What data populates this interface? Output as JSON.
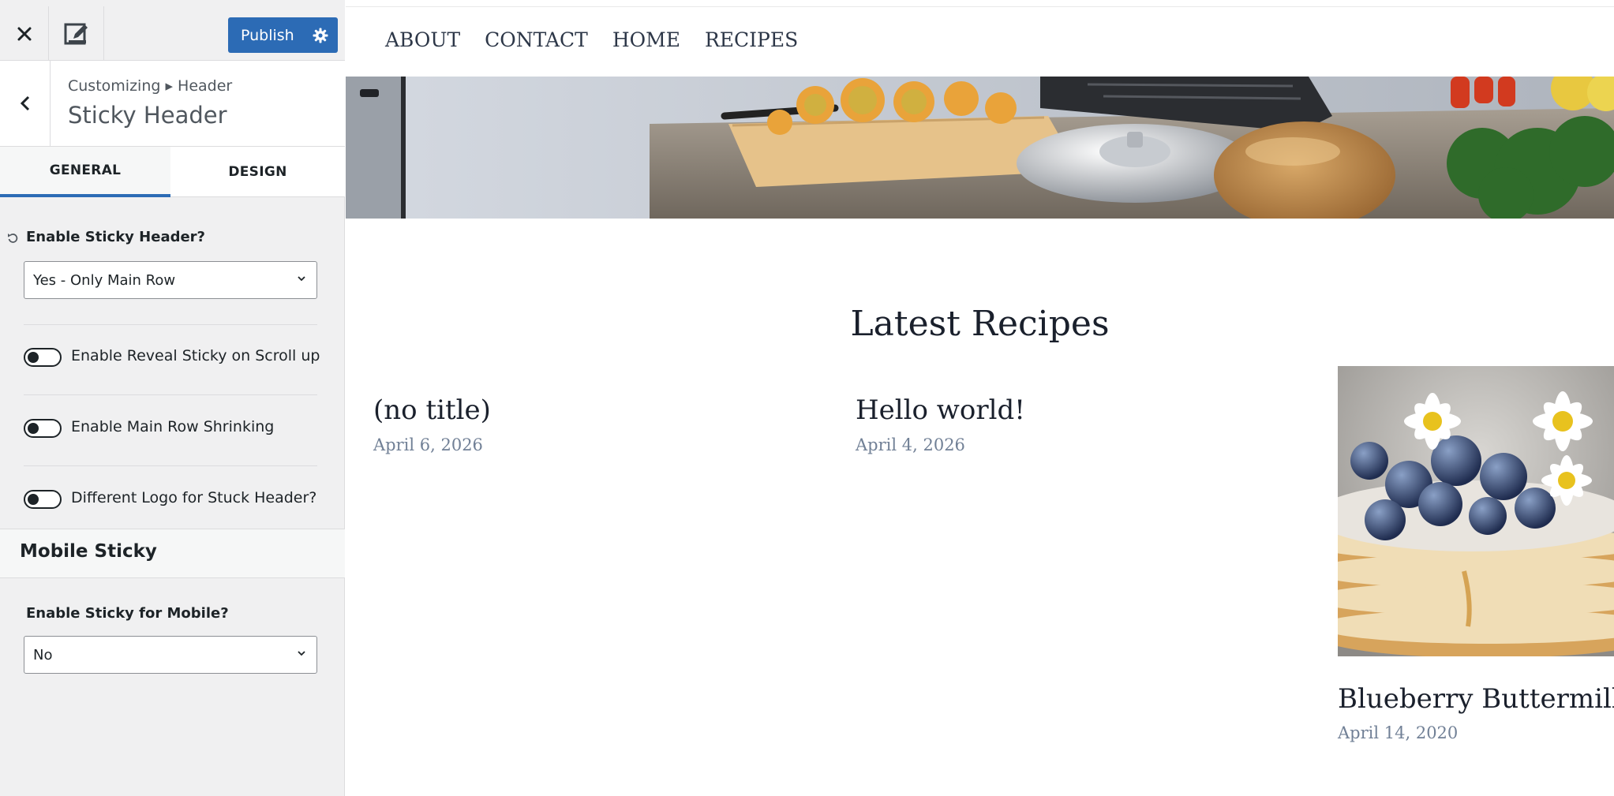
{
  "topbar": {
    "close_icon": "close-icon",
    "device_icon": "pencil-square-icon",
    "publish_label": "Publish",
    "publish_settings_icon": "gear-icon",
    "accent_color": "#2c6bb5"
  },
  "section": {
    "breadcrumb": "Customizing ▸ Header",
    "title": "Sticky Header"
  },
  "tabs": [
    {
      "label": "GENERAL",
      "active": true
    },
    {
      "label": "DESIGN",
      "active": false
    }
  ],
  "general": {
    "sticky_label": "Enable Sticky Header?",
    "sticky_value": "Yes - Only Main Row",
    "toggles": [
      {
        "label": "Enable Reveal Sticky on Scroll up",
        "checked": false
      },
      {
        "label": "Enable Main Row Shrinking",
        "checked": false
      },
      {
        "label": "Different Logo for Stuck Header?",
        "checked": false
      }
    ]
  },
  "mobile": {
    "title": "Mobile Sticky",
    "label": "Enable Sticky for Mobile?",
    "value": "No"
  },
  "preview": {
    "nav": [
      "ABOUT",
      "CONTACT",
      "HOME",
      "RECIPES"
    ],
    "heading": "Latest Recipes",
    "posts": [
      {
        "title": "(no title)",
        "date": "April 6, 2026"
      },
      {
        "title": "Hello world!",
        "date": "April 4, 2026"
      },
      {
        "title": "Blueberry Buttermilk P",
        "date": "April 14, 2020"
      }
    ]
  }
}
